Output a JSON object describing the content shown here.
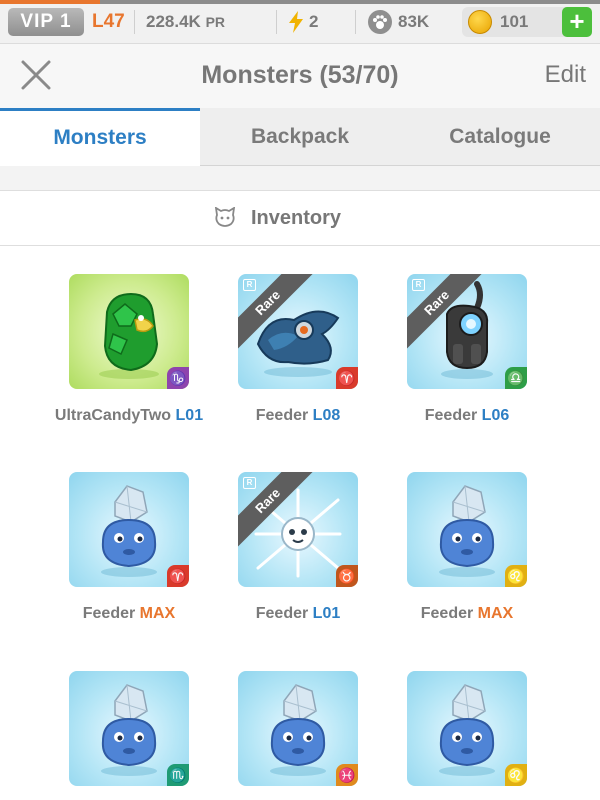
{
  "status_bar": {
    "vip_label": "VIP 1",
    "level": "L47",
    "power": "228.4K",
    "power_unit": "PR",
    "energy": "2",
    "paw_count": "83K",
    "coins": "101",
    "add_button": "+"
  },
  "header": {
    "title": "Monsters (53/70)",
    "edit_label": "Edit"
  },
  "tabs": [
    {
      "label": "Monsters",
      "active": true
    },
    {
      "label": "Backpack",
      "active": false
    },
    {
      "label": "Catalogue",
      "active": false
    }
  ],
  "section": {
    "label": "Inventory"
  },
  "monsters": [
    {
      "name": "UltraCandyTwo",
      "level": "L01",
      "rarity": "",
      "zodiac": "♑",
      "zodiac_color": "#8e44ad",
      "bg": "green"
    },
    {
      "name": "Feeder",
      "level": "L08",
      "rarity": "Rare",
      "zodiac": "♈",
      "zodiac_color": "#d93a2b",
      "bg": "blue"
    },
    {
      "name": "Feeder",
      "level": "L06",
      "rarity": "Rare",
      "zodiac": "♎",
      "zodiac_color": "#2e9e47",
      "bg": "blue"
    },
    {
      "name": "Feeder",
      "level": "MAX",
      "rarity": "",
      "zodiac": "♈",
      "zodiac_color": "#d93a2b",
      "bg": "blue"
    },
    {
      "name": "Feeder",
      "level": "L01",
      "rarity": "Rare",
      "zodiac": "♉",
      "zodiac_color": "#c0561d",
      "bg": "blue"
    },
    {
      "name": "Feeder",
      "level": "MAX",
      "rarity": "",
      "zodiac": "♌",
      "zodiac_color": "#e1b012",
      "bg": "blue"
    },
    {
      "name": "",
      "level": "",
      "rarity": "",
      "zodiac": "♏",
      "zodiac_color": "#1f9b74",
      "bg": "blue"
    },
    {
      "name": "",
      "level": "",
      "rarity": "",
      "zodiac": "♓",
      "zodiac_color": "#e08a1e",
      "bg": "blue"
    },
    {
      "name": "",
      "level": "",
      "rarity": "",
      "zodiac": "♌",
      "zodiac_color": "#e1b012",
      "bg": "blue"
    }
  ],
  "rare_tag": "R"
}
